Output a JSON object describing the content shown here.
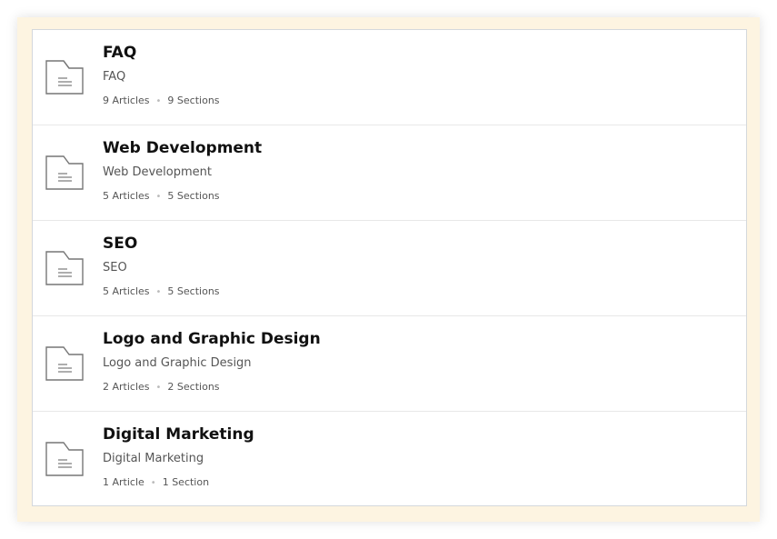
{
  "categories": [
    {
      "title": "FAQ",
      "description": "FAQ",
      "articles": "9 Articles",
      "separator": "•",
      "sections": "9 Sections",
      "icon": "folder-icon"
    },
    {
      "title": "Web Development",
      "description": "Web Development",
      "articles": "5 Articles",
      "separator": "•",
      "sections": "5 Sections",
      "icon": "folder-icon"
    },
    {
      "title": "SEO",
      "description": "SEO",
      "articles": "5 Articles",
      "separator": "•",
      "sections": "5 Sections",
      "icon": "folder-icon"
    },
    {
      "title": "Logo and Graphic Design",
      "description": "Logo and Graphic Design",
      "articles": "2 Articles",
      "separator": "•",
      "sections": "2 Sections",
      "icon": "folder-icon"
    },
    {
      "title": "Digital Marketing",
      "description": "Digital Marketing",
      "articles": "1 Article",
      "separator": "•",
      "sections": "1 Section",
      "icon": "folder-icon"
    }
  ],
  "colors": {
    "frame_background": "#fdf4e1",
    "card_background": "#ffffff",
    "title": "#111111",
    "text": "#555555",
    "icon_stroke": "#777777"
  }
}
